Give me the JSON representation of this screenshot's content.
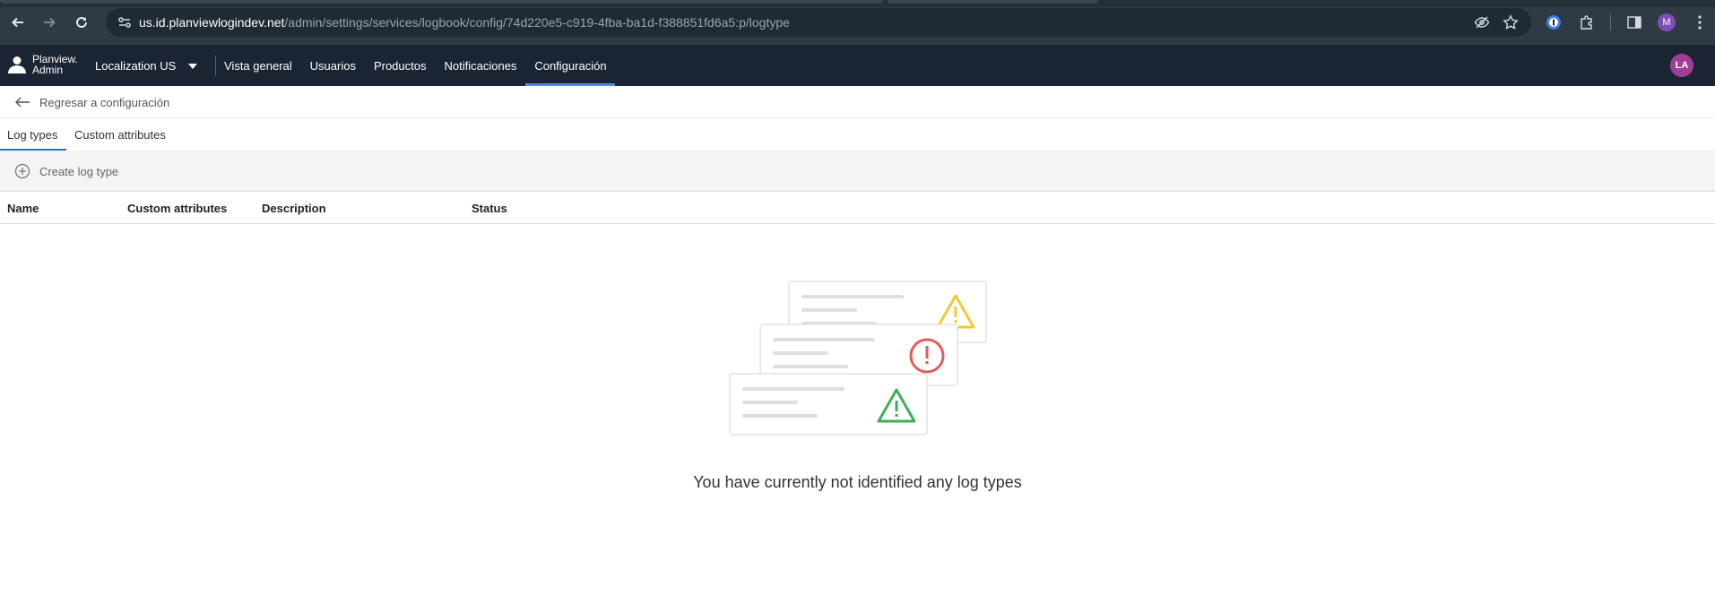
{
  "browser": {
    "url_host": "us.id.planviewlogindev.net",
    "url_path": "/admin/settings/services/logbook/config/74d220e5-c919-4fba-ba1d-f388851fd6a5:p/logtype",
    "profile_initial": "M"
  },
  "header": {
    "brand_line1": "Planview.",
    "brand_line2": "Admin",
    "locale": "Localization US",
    "nav": [
      {
        "label": "Vista general"
      },
      {
        "label": "Usuarios"
      },
      {
        "label": "Productos"
      },
      {
        "label": "Notificaciones"
      },
      {
        "label": "Configuración",
        "active": true
      }
    ],
    "avatar_initials": "LA",
    "accent_color": "#4a8fe7"
  },
  "back_link": {
    "label": "Regresar a configuración"
  },
  "tabs": [
    {
      "label": "Log types",
      "active": true
    },
    {
      "label": "Custom attributes"
    }
  ],
  "toolbar": {
    "create_label": "Create log type"
  },
  "table": {
    "columns": [
      "Name",
      "Custom attributes",
      "Description",
      "Status"
    ]
  },
  "empty_state": {
    "message": "You have currently not identified any log types",
    "icons": [
      "warning-yellow-icon",
      "error-red-icon",
      "warning-green-icon"
    ]
  }
}
